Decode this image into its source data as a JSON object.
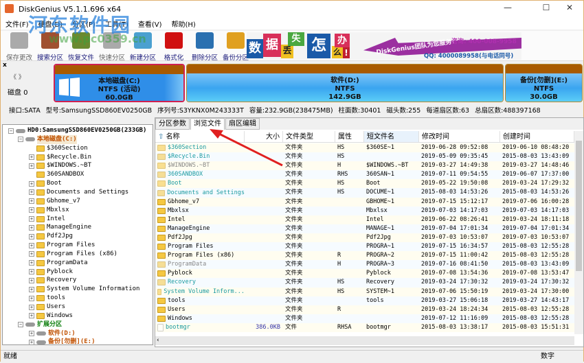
{
  "app": {
    "title": "DiskGenius V5.1.1.696 x64",
    "watermark": "河东软件园",
    "watermark_url": "www.pc0359.cn"
  },
  "window_controls": {
    "minimize": "—",
    "maximize": "☐",
    "close": "✕"
  },
  "menu": [
    "文件(F)",
    "硬盘(D)",
    "分区(P)",
    "工具(T)",
    "查看(V)",
    "帮助(H)"
  ],
  "toolbar": [
    {
      "label": "保存更改",
      "icon": "save-icon",
      "color": "#aaaaaa",
      "disabled": true
    },
    {
      "label": "搜索分区",
      "icon": "search-icon",
      "color": "#a05030"
    },
    {
      "label": "恢复文件",
      "icon": "recover-icon",
      "color": "#6a8a30"
    },
    {
      "label": "快速分区",
      "icon": "quick-partition-icon",
      "color": "#aaaaaa",
      "disabled": true
    },
    {
      "label": "新建分区",
      "icon": "new-partition-icon",
      "color": "#4aa0d0"
    },
    {
      "label": "格式化",
      "icon": "format-icon",
      "color": "#d01010"
    },
    {
      "label": "删除分区",
      "icon": "delete-icon",
      "color": "#2a70b0"
    },
    {
      "label": "备份分区",
      "icon": "backup-icon",
      "color": "#e0a020"
    }
  ],
  "banner": {
    "chars": [
      "数",
      "据",
      "丢",
      "失",
      "怎",
      "么",
      "办",
      "!"
    ],
    "slogan": "DiskGenius团队为您服务!",
    "phone": "咨询: 400-008-9958",
    "qq": "QQ: 4000089958(与电话同号)"
  },
  "disk": {
    "label": "磁盘 0",
    "close": "x",
    "nav": "《 》",
    "partitions": [
      {
        "name": "本地磁盘(C:)",
        "fs": "NTFS (活动)",
        "size": "60.0GB"
      },
      {
        "name": "软件(D:)",
        "fs": "NTFS",
        "size": "142.9GB"
      },
      {
        "name": "备份[勿删](E:)",
        "fs": "NTFS",
        "size": "30.0GB"
      }
    ],
    "info": [
      "接口:SATA",
      "型号:SamsungSSD860EV0250GB",
      "序列号:S3YKNX0M243333T",
      "容量:232.9GB(238475MB)",
      "柱面数:30401",
      "磁头数:255",
      "每道扇区数:63",
      "总扇区数:488397168"
    ]
  },
  "tree": {
    "disk": "HD0:SamsungSSD860EV0250GB(233GB)",
    "c_drive": "本地磁盘(C:)",
    "folders": [
      "$360Section",
      "$Recycle.Bin",
      "$WINDOWS.~BT",
      "360SANDBOX",
      "Boot",
      "Documents and Settings",
      "Gbhome_v7",
      "Mbxlsx",
      "Intel",
      "ManageEngine",
      "Pdf2Jpg",
      "Program Files",
      "Program Files (x86)",
      "ProgramData",
      "Pyblock",
      "Recovery",
      "System Volume Information",
      "tools",
      "Users",
      "Windows"
    ],
    "extended": "扩展分区",
    "d_drive": "软件(D:)",
    "e_drive": "备份[勿删](E:)"
  },
  "tabs": [
    {
      "label": "分区参数"
    },
    {
      "label": "浏览文件",
      "active": true
    },
    {
      "label": "扇区编辑"
    }
  ],
  "columns": [
    "名称",
    "大小",
    "文件类型",
    "属性",
    "短文件名",
    "修改时间",
    "创建时间"
  ],
  "files": [
    [
      "$360Section",
      "",
      "文件夹",
      "HS",
      "$360SE~1",
      "2019-06-28 09:52:08",
      "2019-06-10 08:48:20",
      "s"
    ],
    [
      "$Recycle.Bin",
      "",
      "文件夹",
      "HS",
      "",
      "2019-05-09 09:35:45",
      "2015-08-03 13:43:09",
      "s"
    ],
    [
      "$WINDOWS.~BT",
      "",
      "文件夹",
      "H",
      "$WINDOWS.~BT",
      "2019-03-27 14:49:38",
      "2019-03-27 14:48:46",
      "h"
    ],
    [
      "360SANDBOX",
      "",
      "文件夹",
      "RHS",
      "360SAN~1",
      "2019-07-11 09:54:55",
      "2019-06-07 17:37:00",
      "s"
    ],
    [
      "Boot",
      "",
      "文件夹",
      "HS",
      "Boot",
      "2019-05-22 19:50:08",
      "2019-03-24 17:29:32",
      "s"
    ],
    [
      "Documents and Settings",
      "",
      "文件夹",
      "HS",
      "DOCUME~1",
      "2015-08-03 14:53:26",
      "2015-08-03 14:53:26",
      "s"
    ],
    [
      "Gbhome_v7",
      "",
      "文件夹",
      "",
      "GBHOME~1",
      "2019-07-15 15:12:17",
      "2019-07-06 16:00:28",
      "n"
    ],
    [
      "Mbxlsx",
      "",
      "文件夹",
      "",
      "Mbxlsx",
      "2019-07-03 14:17:03",
      "2019-07-03 14:17:03",
      "n"
    ],
    [
      "Intel",
      "",
      "文件夹",
      "",
      "Intel",
      "2019-06-22 08:26:41",
      "2019-03-24 18:11:18",
      "n"
    ],
    [
      "ManageEngine",
      "",
      "文件夹",
      "",
      "MANAGE~1",
      "2019-07-04 17:01:34",
      "2019-07-04 17:01:34",
      "n"
    ],
    [
      "Pdf2Jpg",
      "",
      "文件夹",
      "",
      "Pdf2Jpg",
      "2019-07-03 10:53:07",
      "2019-07-03 10:53:07",
      "n"
    ],
    [
      "Program Files",
      "",
      "文件夹",
      "",
      "PROGRA~1",
      "2019-07-15 16:34:57",
      "2015-08-03 12:55:28",
      "n"
    ],
    [
      "Program Files (x86)",
      "",
      "文件夹",
      "R",
      "PROGRA~2",
      "2019-07-15 11:00:42",
      "2015-08-03 12:55:28",
      "n"
    ],
    [
      "ProgramData",
      "",
      "文件夹",
      "H",
      "PROGRA~3",
      "2019-07-16 08:41:50",
      "2015-08-03 13:43:09",
      "h"
    ],
    [
      "Pyblock",
      "",
      "文件夹",
      "",
      "Pyblock",
      "2019-07-08 13:54:36",
      "2019-07-08 13:53:47",
      "n"
    ],
    [
      "Recovery",
      "",
      "文件夹",
      "HS",
      "Recovery",
      "2019-03-24 17:30:32",
      "2019-03-24 17:30:32",
      "s"
    ],
    [
      "System Volume Inform...",
      "",
      "文件夹",
      "HS",
      "SYSTEM~1",
      "2019-07-06 15:50:19",
      "2019-03-24 17:30:00",
      "s"
    ],
    [
      "tools",
      "",
      "文件夹",
      "",
      "tools",
      "2019-03-27 15:06:18",
      "2019-03-27 14:43:17",
      "n"
    ],
    [
      "Users",
      "",
      "文件夹",
      "R",
      "",
      "2019-03-24 18:24:34",
      "2015-08-03 12:55:28",
      "n"
    ],
    [
      "Windows",
      "",
      "文件夹",
      "",
      "",
      "2019-07-12 11:16:09",
      "2015-08-03 12:55:28",
      "n"
    ],
    [
      "bootmgr",
      "386.0KB",
      "文件",
      "RHSA",
      "bootmgr",
      "2015-08-03 13:38:17",
      "2015-08-03 15:51:31",
      "s"
    ]
  ],
  "colors": {
    "system": "#1a9aa0",
    "hidden": "#888888",
    "normal": "#000000",
    "accent_red": "#d02040"
  },
  "status": {
    "left": "就绪",
    "right": "数字"
  }
}
